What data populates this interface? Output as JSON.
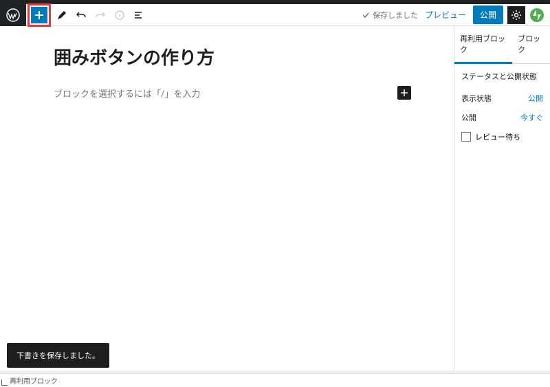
{
  "toolbar": {
    "save_status": "保存しました",
    "preview": "プレビュー",
    "publish": "公開"
  },
  "editor": {
    "title": "囲みボタンの作り方",
    "placeholder": "ブロックを選択するには「/」を入力"
  },
  "sidebar": {
    "tabs": {
      "reusable": "再利用ブロック",
      "block": "ブロック"
    },
    "panel_title": "ステータスと公開状態",
    "visibility": {
      "label": "表示状態",
      "value": "公開"
    },
    "publish": {
      "label": "公開",
      "value": "今すぐ"
    },
    "pending_review": "レビュー待ち"
  },
  "snackbar": "下書きを保存しました。",
  "footer": "再利用ブロック"
}
